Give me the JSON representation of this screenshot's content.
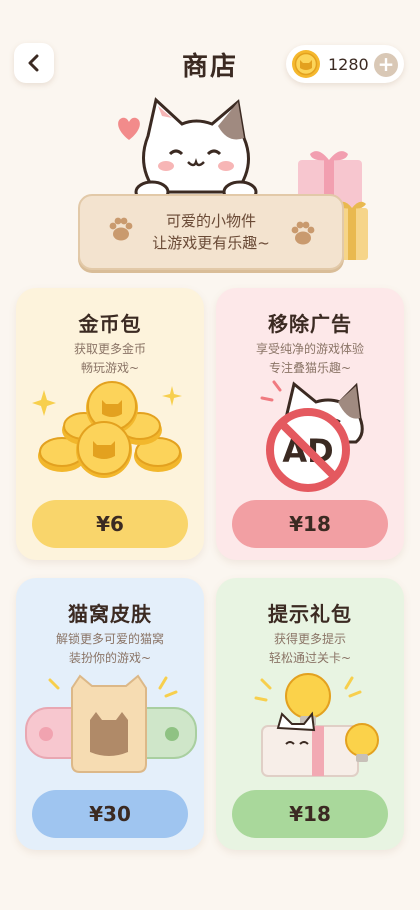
{
  "header": {
    "title": "商店",
    "coin_count": "1280",
    "plus_label": "+"
  },
  "banner": {
    "line1": "可爱的小物件",
    "line2": "让游戏更有乐趣~"
  },
  "products": [
    {
      "title": "金币包",
      "desc1": "获取更多金币",
      "desc2": "畅玩游戏~",
      "price": "¥6",
      "icon": "coin-pile-icon"
    },
    {
      "title": "移除广告",
      "desc1": "享受纯净的游戏体验",
      "desc2": "专注叠猫乐趣~",
      "price": "¥18",
      "icon": "no-ads-icon"
    },
    {
      "title": "猫窝皮肤",
      "desc1": "解锁更多可爱的猫窝",
      "desc2": "装扮你的游戏~",
      "price": "¥30",
      "icon": "cat-bed-icon"
    },
    {
      "title": "提示礼包",
      "desc1": "获得更多提示",
      "desc2": "轻松通过关卡~",
      "price": "¥18",
      "icon": "hint-bulb-icon"
    }
  ],
  "ad_text": "AD",
  "colors": {
    "card1_bg": "#fdf3dc",
    "card1_btn": "#f9d56b",
    "card2_bg": "#fde8e9",
    "card2_btn": "#f29fa3",
    "card3_bg": "#e4effa",
    "card3_btn": "#9fc5f0",
    "card4_bg": "#e8f4e2",
    "card4_btn": "#a9d89b"
  }
}
